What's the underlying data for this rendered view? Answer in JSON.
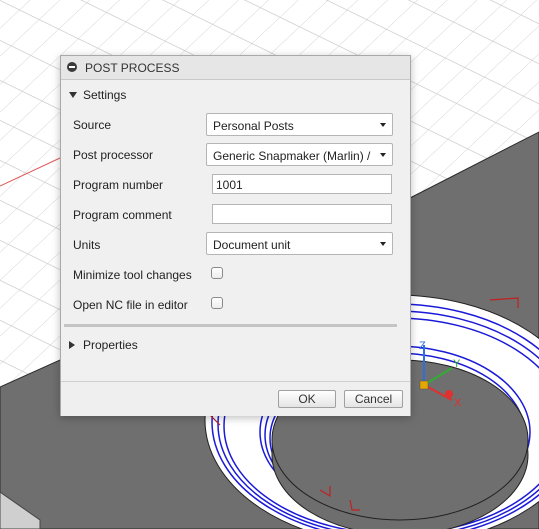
{
  "dialog": {
    "title": "POST PROCESS",
    "settings_section": "Settings",
    "rows": {
      "source": {
        "label": "Source",
        "value": "Personal Posts"
      },
      "post_processor": {
        "label": "Post processor",
        "value": "Generic Snapmaker (Marlin) / ..."
      },
      "program_number": {
        "label": "Program number",
        "value": "1001"
      },
      "program_comment": {
        "label": "Program comment",
        "value": ""
      },
      "units": {
        "label": "Units",
        "value": "Document unit"
      },
      "minimize_tool_changes": {
        "label": "Minimize tool changes",
        "checked": false
      },
      "open_nc_file": {
        "label": "Open NC file in editor",
        "checked": false
      }
    },
    "properties_section": "Properties",
    "ok_label": "OK",
    "cancel_label": "Cancel"
  },
  "axes": {
    "z": "Z",
    "y": "Y",
    "x": "X"
  },
  "colors": {
    "toolpath": "#1a1ad8",
    "axis_x": "#e03030",
    "axis_y": "#2fae2f",
    "axis_z": "#2b6fe0",
    "stock": "#6e6e6e"
  }
}
